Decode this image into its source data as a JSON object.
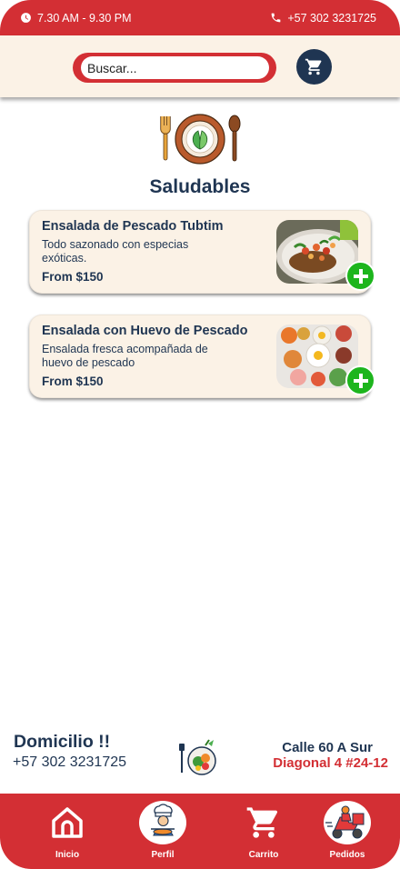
{
  "status_bar": {
    "hours": "7.30 AM - 9.30 PM",
    "phone": "+57 302 3231725"
  },
  "search": {
    "placeholder": "Buscar..."
  },
  "category": {
    "title": "Saludables",
    "icon": "healthy-plate-icon"
  },
  "products": [
    {
      "title": "Ensalada de Pescado Tubtim",
      "description": "Todo sazonado con especias exóticas.",
      "price": "From $150",
      "image": "fish-salad-photo"
    },
    {
      "title": "Ensalada con Huevo de Pescado",
      "description": "Ensalada fresca acompañada de huevo de pescado",
      "price": "From $150",
      "image": "egg-breakfast-photo"
    }
  ],
  "footer": {
    "delivery_title": "Domicilio !!",
    "delivery_phone": "+57 302 3231725",
    "address_line1": "Calle 60 A Sur",
    "address_line2": "Diagonal 4  #24-12"
  },
  "nav": [
    {
      "label": "Inicio",
      "icon": "home-icon"
    },
    {
      "label": "Perfil",
      "icon": "chef-avatar-icon"
    },
    {
      "label": "Carrito",
      "icon": "cart-icon"
    },
    {
      "label": "Pedidos",
      "icon": "delivery-scooter-icon"
    }
  ],
  "colors": {
    "brand_red": "#d32f34",
    "navy": "#1f3552",
    "cream": "#fbf2e6",
    "add_green": "#1db51d"
  }
}
